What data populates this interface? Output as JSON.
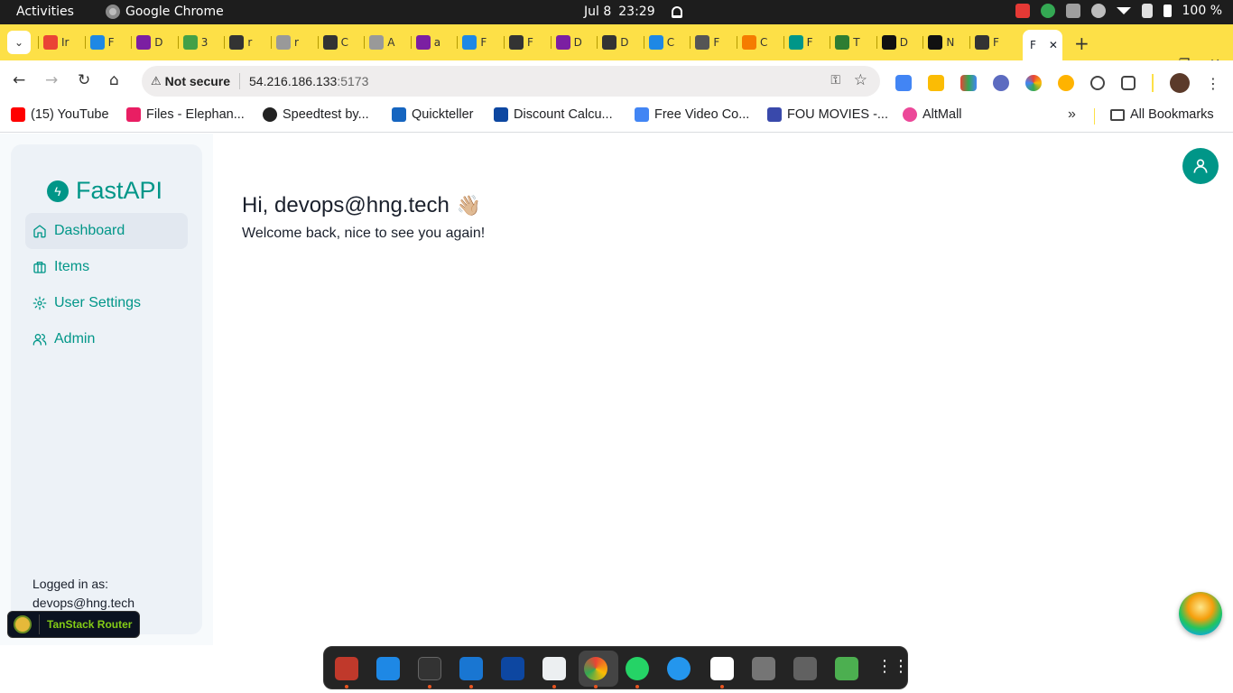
{
  "os": {
    "activities": "Activities",
    "app_name": "Google Chrome",
    "date": "Jul 8",
    "time": "23:29",
    "battery": "100 %"
  },
  "browser": {
    "active_tab_initial": "F",
    "url_warning": "Not secure",
    "url_host": "54.216.186.133",
    "url_port": ":5173",
    "mini_tabs": [
      "Ir",
      "F",
      "D",
      "3",
      "r",
      "r",
      "C",
      "A",
      "a",
      "F",
      "F",
      "D",
      "D",
      "C",
      "F",
      "C",
      "F",
      "T",
      "D",
      "N",
      "F"
    ],
    "bookmarks": [
      "(15) YouTube",
      "Files - Elephan...",
      "Speedtest by...",
      "Quickteller",
      "Discount Calcu...",
      "Free Video Co...",
      "FOU MOVIES -...",
      "AltMall"
    ],
    "all_bookmarks": "All Bookmarks"
  },
  "app": {
    "logo_text": "FastAPI",
    "nav": [
      {
        "label": "Dashboard",
        "icon": "home-icon",
        "active": true
      },
      {
        "label": "Items",
        "icon": "briefcase-icon",
        "active": false
      },
      {
        "label": "User Settings",
        "icon": "gear-icon",
        "active": false
      },
      {
        "label": "Admin",
        "icon": "users-icon",
        "active": false
      }
    ],
    "logged_in_label": "Logged in as:",
    "logged_in_user": "devops@hng.tech",
    "greeting": "Hi, devops@hng.tech",
    "greeting_emoji": "👋🏼",
    "welcome": "Welcome back, nice to see you again!",
    "devtools_label": "TanStack Router",
    "accent": "#009688"
  }
}
